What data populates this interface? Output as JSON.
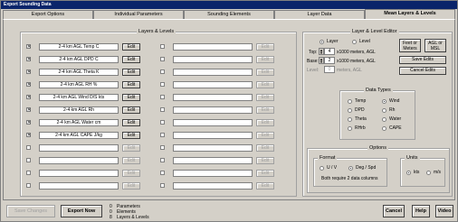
{
  "window": {
    "title": "Export Sounding Data"
  },
  "tabs": [
    {
      "label": "Export Options"
    },
    {
      "label": "Individual Parameters"
    },
    {
      "label": "Sounding Elements"
    },
    {
      "label": "Layer Data"
    },
    {
      "label": "Mean Layers & Levels"
    }
  ],
  "layers_panel": {
    "title": "Layers & Levels",
    "edit_label": "Edit",
    "left_rows": [
      {
        "checked": true,
        "value": "2-4 km AGL Temp  C"
      },
      {
        "checked": true,
        "value": "2-4 km AGL DPD  C"
      },
      {
        "checked": true,
        "value": "2-4 km AGL Theta K"
      },
      {
        "checked": true,
        "value": "2-4 km AGL RH  %"
      },
      {
        "checked": true,
        "value": "2-4 km AGL Wind D/S kts"
      },
      {
        "checked": true,
        "value": "2-4 km AGL Rh"
      },
      {
        "checked": true,
        "value": "2-4 km AGL Water  cm"
      },
      {
        "checked": true,
        "value": "2-4 km AGL CAPE J/kg"
      },
      {
        "checked": false,
        "value": ""
      },
      {
        "checked": false,
        "value": ""
      },
      {
        "checked": false,
        "value": ""
      },
      {
        "checked": false,
        "value": ""
      }
    ],
    "right_rows": [
      {
        "checked": false,
        "value": ""
      },
      {
        "checked": false,
        "value": ""
      },
      {
        "checked": false,
        "value": ""
      },
      {
        "checked": false,
        "value": ""
      },
      {
        "checked": false,
        "value": ""
      },
      {
        "checked": false,
        "value": ""
      },
      {
        "checked": false,
        "value": ""
      },
      {
        "checked": false,
        "value": ""
      },
      {
        "checked": false,
        "value": ""
      },
      {
        "checked": false,
        "value": ""
      },
      {
        "checked": false,
        "value": ""
      },
      {
        "checked": false,
        "value": ""
      }
    ]
  },
  "editor": {
    "title": "Layer & Level Editor",
    "layer_label": "Layer",
    "level_label": "Level",
    "top_label": "Top:",
    "top_value": "4",
    "top_units": "x1000 meters, AGL",
    "base_label": "Base:",
    "base_value": "2",
    "base_units": "x1000 meters, AGL",
    "level_field_label": "Level:",
    "level_value": "0",
    "level_units": "meters, AGL",
    "feet_meters": "Feet or Meters",
    "agl_msl": "AGL or MSL",
    "save_edits": "Save Edits",
    "cancel_edits": "Cancel Edits",
    "data_types": {
      "title": "Data Types",
      "items": [
        {
          "label": "Temp",
          "selected": false
        },
        {
          "label": "Wind",
          "selected": true
        },
        {
          "label": "DPD",
          "selected": false
        },
        {
          "label": "Rh",
          "selected": false
        },
        {
          "label": "Theta",
          "selected": false
        },
        {
          "label": "Water",
          "selected": false
        },
        {
          "label": "RHrb",
          "selected": false
        },
        {
          "label": "CAPE",
          "selected": false
        }
      ]
    },
    "options": {
      "title": "Options",
      "format_title": "Format",
      "uv_label": "U / V",
      "degspd_label": "Deg / Spd",
      "format_note": "Both require 2 data columns",
      "units_title": "Units",
      "kts_label": "kts",
      "ms_label": "m/s"
    }
  },
  "bottom": {
    "save_changes": "Save Changes",
    "export_now": "Export Now",
    "stats": [
      {
        "count": "0",
        "label": "Parameters"
      },
      {
        "count": "0",
        "label": "Elements"
      },
      {
        "count": "8",
        "label": "Layers & Levels"
      }
    ],
    "cancel": "Cancel",
    "help": "Help",
    "video": "Video"
  }
}
